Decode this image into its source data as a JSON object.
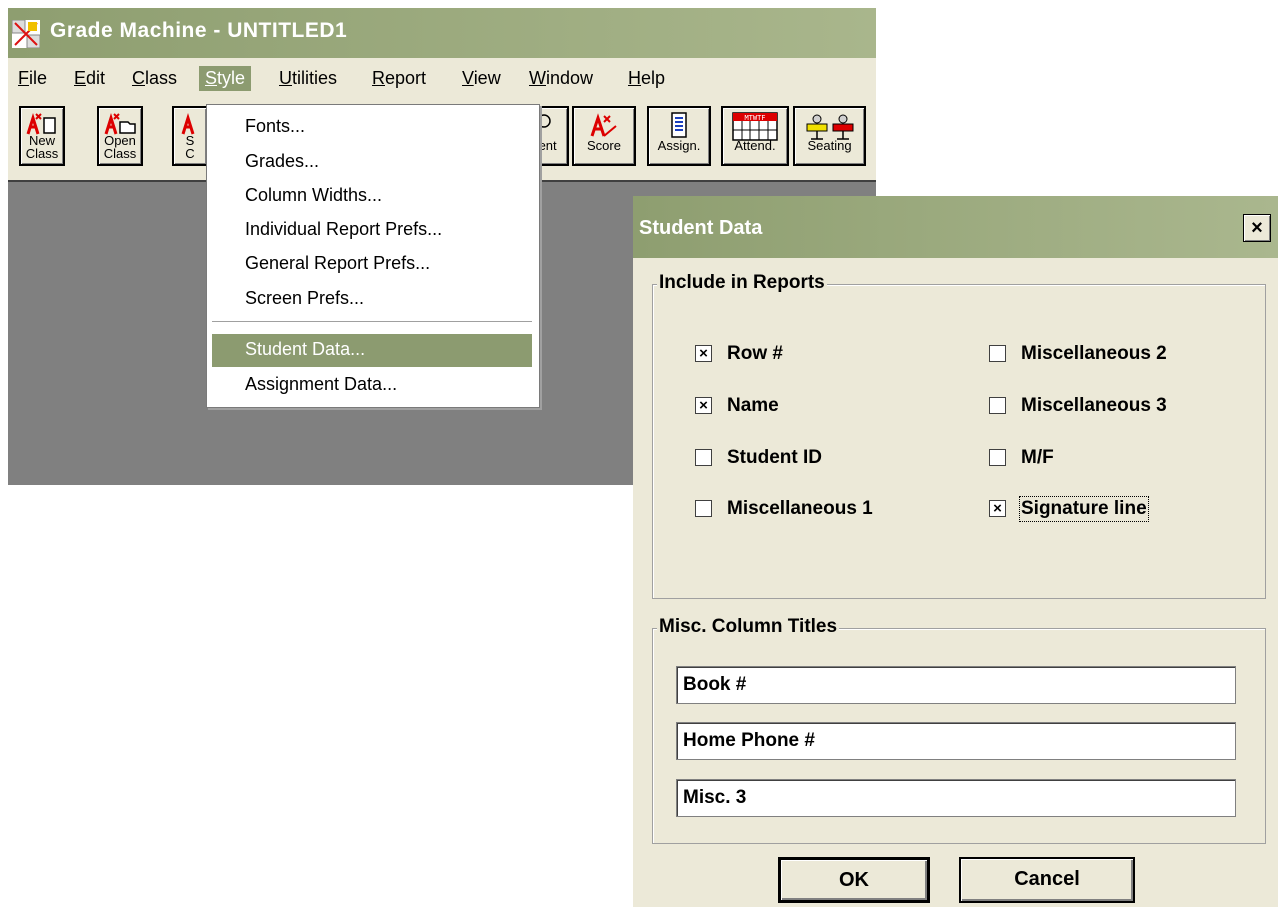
{
  "app": {
    "title": "Grade Machine - UNTITLED1",
    "menu": [
      "File",
      "Edit",
      "Class",
      "Style",
      "Utilities",
      "Report",
      "View",
      "Window",
      "Help"
    ],
    "active_menu": "Style",
    "toolbar": [
      {
        "label1": "New",
        "label2": "Class",
        "icon": "new-class-icon"
      },
      {
        "label1": "Open",
        "label2": "Class",
        "icon": "open-class-icon"
      },
      {
        "label1": "S",
        "label2": "C",
        "icon": "save-class-icon"
      },
      {
        "label1": "",
        "label2": "dent",
        "icon": "student-icon"
      },
      {
        "label1": "",
        "label2": "Score",
        "icon": "score-icon"
      },
      {
        "label1": "",
        "label2": "Assign.",
        "icon": "assignment-icon"
      },
      {
        "label1": "",
        "label2": "Attend.",
        "icon": "attendance-icon",
        "icon_text": "MTWTF"
      },
      {
        "label1": "",
        "label2": "Seating",
        "icon": "seating-icon"
      }
    ]
  },
  "style_menu": {
    "items": [
      "Fonts...",
      "Grades...",
      "Column Widths...",
      "Individual Report Prefs...",
      "General Report Prefs...",
      "Screen Prefs...",
      "Student Data...",
      "Assignment Data..."
    ],
    "selected": "Student Data..."
  },
  "dialog": {
    "title": "Student Data",
    "close_glyph": "×",
    "include_group": "Include in Reports",
    "checkboxes": [
      {
        "label": "Row #",
        "checked": true
      },
      {
        "label": "Name",
        "checked": true
      },
      {
        "label": "Student ID",
        "checked": false
      },
      {
        "label": "Miscellaneous 1",
        "checked": false
      },
      {
        "label": "Miscellaneous 2",
        "checked": false
      },
      {
        "label": "Miscellaneous 3",
        "checked": false
      },
      {
        "label": "M/F",
        "checked": false
      },
      {
        "label": "Signature line",
        "checked": true
      }
    ],
    "misc_group": "Misc. Column Titles",
    "misc_titles": [
      "Book #",
      "Home Phone #",
      "Misc. 3"
    ],
    "ok_label": "OK",
    "cancel_label": "Cancel",
    "check_mark": "×"
  }
}
